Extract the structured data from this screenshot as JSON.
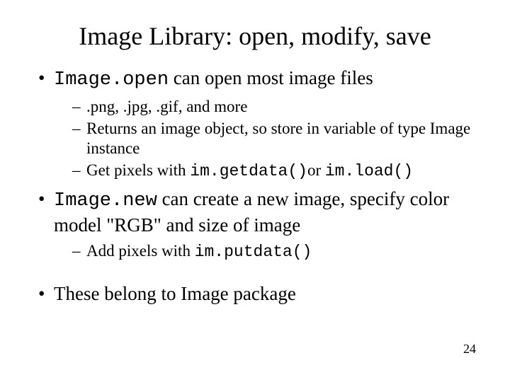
{
  "title": "Image Library: open, modify, save",
  "b1": {
    "code": "Image.open",
    "rest": " can open most image files",
    "sub1": ".png, .jpg, .gif, and more",
    "sub2": "Returns an image object, so store in variable of type Image instance",
    "sub3_pre": "Get pixels with ",
    "sub3_code1": "im.getdata()",
    "sub3_mid": "or ",
    "sub3_code2": "im.load()"
  },
  "b2": {
    "code": "Image.new",
    "rest": " can create a new image, specify color model \"RGB\" and size of image",
    "sub1_pre": "Add pixels with ",
    "sub1_code": "im.putdata()"
  },
  "b3": "These belong to Image package",
  "page": "24"
}
